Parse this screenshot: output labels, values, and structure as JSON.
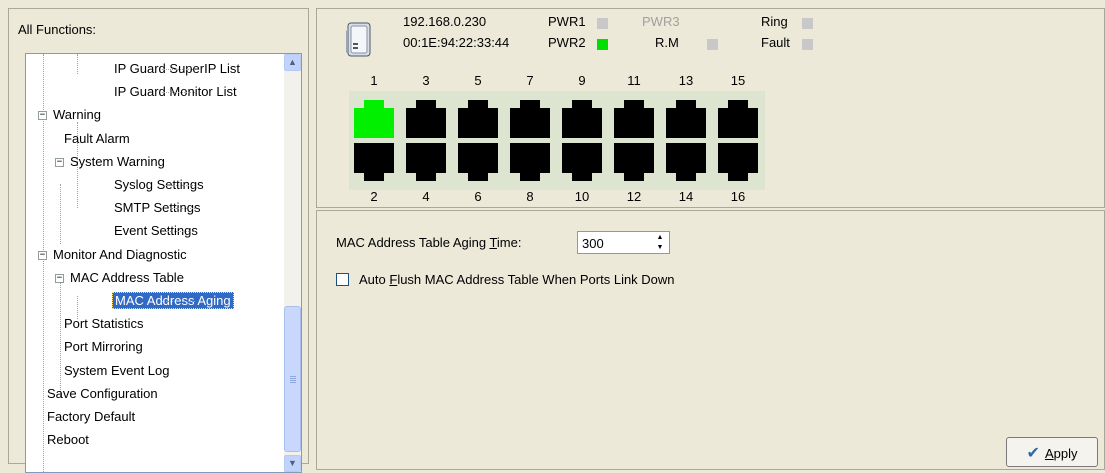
{
  "left": {
    "title": "All Functions:",
    "tree": [
      {
        "label": "IP Guard SuperIP List"
      },
      {
        "label": "IP Guard Monitor List"
      },
      {
        "label": "Warning",
        "expander": "−"
      },
      {
        "label": "Fault Alarm"
      },
      {
        "label": "System Warning",
        "expander": "−"
      },
      {
        "label": "Syslog Settings"
      },
      {
        "label": "SMTP Settings"
      },
      {
        "label": "Event Settings"
      },
      {
        "label": "Monitor And Diagnostic",
        "expander": "−"
      },
      {
        "label": "MAC Address Table",
        "expander": "−"
      },
      {
        "label": "MAC Address Aging",
        "selected": true
      },
      {
        "label": "Port Statistics"
      },
      {
        "label": "Port Mirroring"
      },
      {
        "label": "System Event Log"
      },
      {
        "label": "Save Configuration"
      },
      {
        "label": "Factory Default"
      },
      {
        "label": "Reboot"
      }
    ],
    "scroll_up_icon": "▲",
    "scroll_down_icon": "▼"
  },
  "device": {
    "ip": "192.168.0.230",
    "mac": "00:1E:94:22:33:44",
    "status": [
      {
        "label": "PWR1",
        "state": "off"
      },
      {
        "label": "PWR2",
        "state": "on"
      },
      {
        "label": "PWR3",
        "state": "none"
      },
      {
        "label": "R.M",
        "state": "off"
      },
      {
        "label": "Ring",
        "state": "off"
      },
      {
        "label": "Fault",
        "state": "off"
      }
    ],
    "ports_top": [
      "1",
      "3",
      "5",
      "7",
      "9",
      "11",
      "13",
      "15"
    ],
    "ports_bottom": [
      "2",
      "4",
      "6",
      "8",
      "10",
      "12",
      "14",
      "16"
    ],
    "ports_up": [
      "1"
    ],
    "colors": {
      "link_up": "#00f000",
      "link_down": "#000000",
      "led_on": "#00e000",
      "led_off": "#c8c8c8"
    }
  },
  "aging": {
    "label_pre": "MAC Address Table Aging ",
    "label_key": "T",
    "label_post": "ime:",
    "value": "300",
    "spin_up_icon": "▲",
    "spin_down_icon": "▼"
  },
  "flush": {
    "label_pre": "Auto ",
    "label_key": "F",
    "label_post": "lush MAC Address Table When Ports Link Down",
    "checked": false
  },
  "apply": {
    "icon": "✔",
    "label_key": "A",
    "label_post": "pply"
  }
}
